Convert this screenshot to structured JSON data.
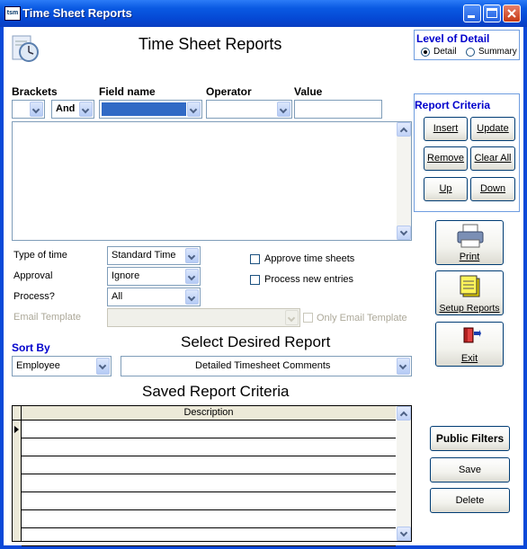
{
  "window": {
    "app_icon": "tsm",
    "title": "Time Sheet Reports"
  },
  "header": {
    "title": "Time Sheet Reports",
    "report_icon": "clock-report-icon"
  },
  "level_of_detail": {
    "title": "Level of Detail",
    "options": [
      "Detail",
      "Summary"
    ],
    "selected": "Detail"
  },
  "criteria": {
    "labels": {
      "brackets": "Brackets",
      "field_name": "Field name",
      "operator": "Operator",
      "value": "Value"
    },
    "and_or_value": "And"
  },
  "report_criteria": {
    "title": "Report Criteria",
    "buttons": {
      "insert": "Insert",
      "update": "Update",
      "remove": "Remove",
      "clear_all": "Clear All",
      "up": "Up",
      "down": "Down"
    }
  },
  "options": {
    "type_of_time": {
      "label": "Type of time",
      "value": "Standard Time"
    },
    "approval": {
      "label": "Approval",
      "value": "Ignore"
    },
    "process": {
      "label": "Process?",
      "value": "All"
    },
    "email_template": {
      "label": "Email Template",
      "value": ""
    },
    "approve_time_sheets": "Approve time sheets",
    "process_new_entries": "Process new entries",
    "only_email_template": "Only Email Template"
  },
  "actions": {
    "print": "Print",
    "setup_reports": "Setup Reports",
    "exit": "Exit"
  },
  "sort_by": {
    "label": "Sort By",
    "value": "Employee"
  },
  "select_report": {
    "label": "Select Desired Report",
    "value": "Detailed Timesheet Comments"
  },
  "saved_criteria": {
    "title": "Saved Report Criteria",
    "column": "Description",
    "rows": [
      "",
      "",
      "",
      "",
      "",
      "",
      ""
    ]
  },
  "filters": {
    "public_filters": "Public Filters",
    "save": "Save",
    "delete": "Delete"
  },
  "colors": {
    "title_bar": "#0a5ae3",
    "highlight": "#316ac5",
    "group_title": "#0000cc",
    "border": "#0a49d8"
  }
}
